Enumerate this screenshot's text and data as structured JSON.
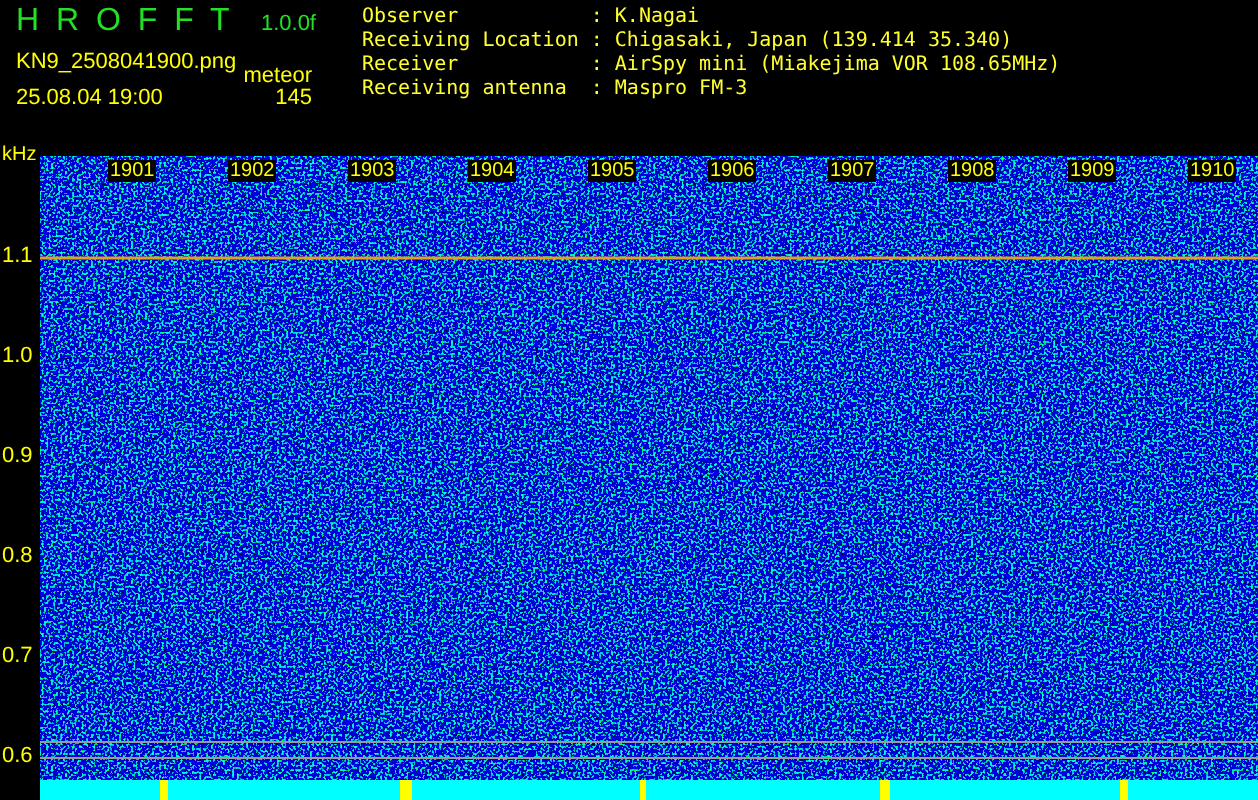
{
  "header": {
    "title": "H R O F F T",
    "version": "1.0.0f",
    "filename": "KN9_2508041900.png",
    "datetime": "25.08.04 19:00",
    "mode_label": "meteor",
    "count": "145"
  },
  "info": [
    {
      "label": "Observer",
      "separator": ":",
      "value": "K.Nagai"
    },
    {
      "label": "Receiving Location",
      "separator": ":",
      "value": "Chigasaki, Japan (139.414 35.340)"
    },
    {
      "label": "Receiver",
      "separator": ":",
      "value": "AirSpy mini (Miakejima VOR 108.65MHz)"
    },
    {
      "label": "Receiving antenna",
      "separator": ":",
      "value": "Maspro FM-3"
    }
  ],
  "spectrogram": {
    "y_unit": "kHz",
    "y_labels": [
      "1.1",
      "1.0",
      "0.9",
      "0.8",
      "0.7",
      "0.6"
    ],
    "time_labels": [
      "1901",
      "1902",
      "1903",
      "1904",
      "1905",
      "1906",
      "1907",
      "1908",
      "1909",
      "1910"
    ]
  }
}
